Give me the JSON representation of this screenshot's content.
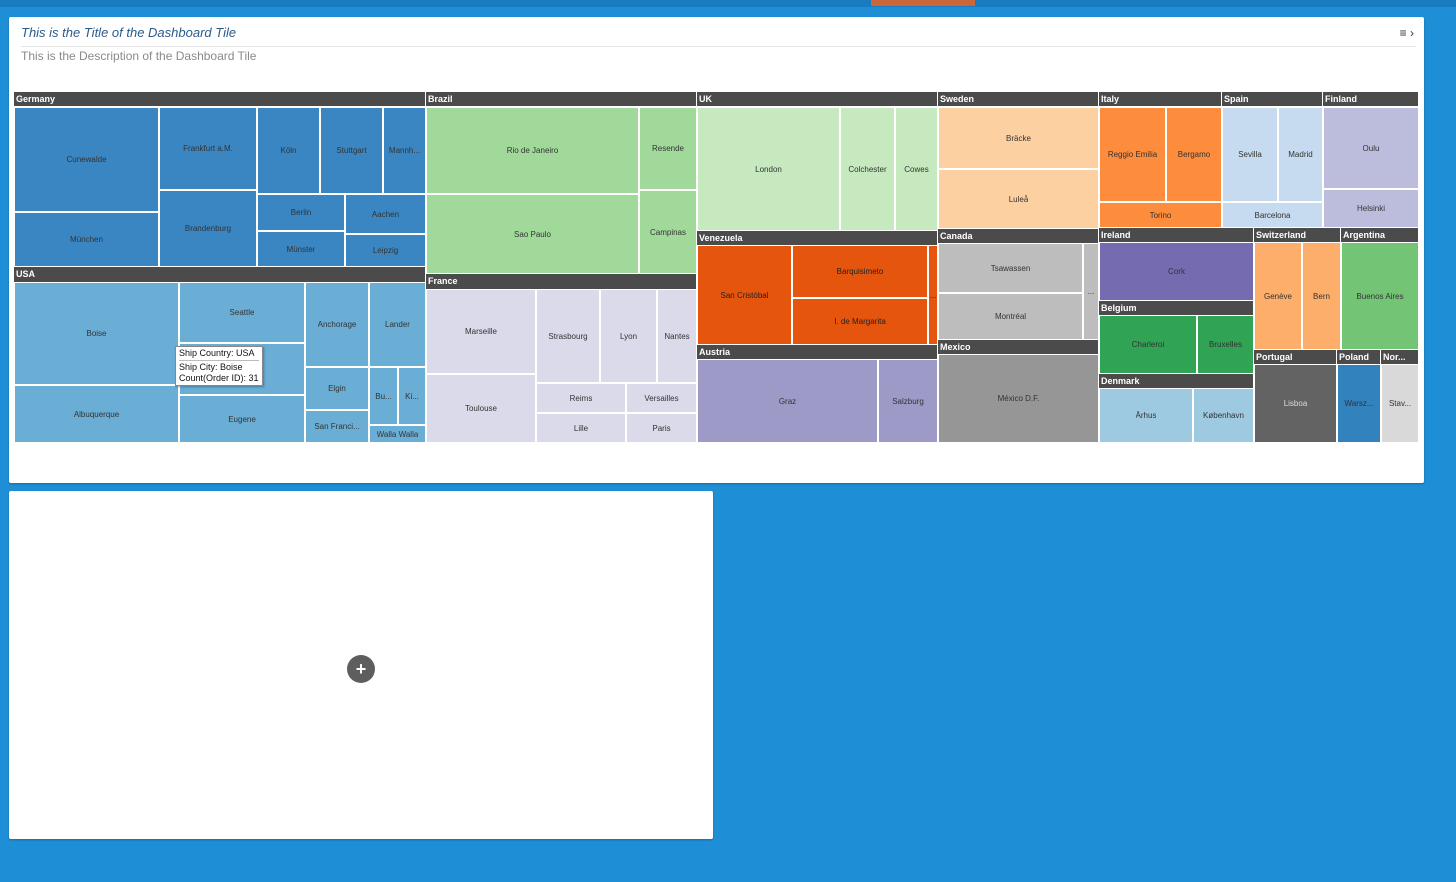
{
  "tile": {
    "title": "This is the Title of the Dashboard Tile",
    "description": "This is the Description of the Dashboard Tile",
    "menu_icon": "hamburger-icon",
    "expand_icon": "chevron-right-icon"
  },
  "tooltip": {
    "country_label": "Ship Country:",
    "country_value": "USA",
    "city_label": "Ship City:",
    "city_value": "Boise",
    "count_label": "Count(Order ID):",
    "count_value": "31"
  },
  "empty_tile": {
    "add_icon": "plus-circle-icon",
    "add_symbol": "+"
  },
  "chart_data": {
    "type": "treemap",
    "measure": "Count(Order ID)",
    "groups": [
      {
        "name": "Germany",
        "color": "#3a86c2",
        "children": [
          "Cunewalde",
          "München",
          "Frankfurt a.M.",
          "Brandenburg",
          "Köln",
          "Stuttgart",
          "Mannh...",
          "Berlin",
          "Aachen",
          "Münster",
          "Leipzig"
        ]
      },
      {
        "name": "USA",
        "color": "#6aaed6",
        "children": [
          "Boise",
          "Albuquerque",
          "Seattle",
          "Eugene",
          "Anchorage",
          "Elgin",
          "San Franci...",
          "Lander",
          "Bu...",
          "Ki...",
          "Walla Walla"
        ]
      },
      {
        "name": "Brazil",
        "color": "#a1d99b",
        "children": [
          "Rio de Janeiro",
          "Sao Paulo",
          "Resende",
          "Campinas"
        ]
      },
      {
        "name": "France",
        "color": "#dadaeb",
        "children": [
          "Marseille",
          "Toulouse",
          "Strasbourg",
          "Lyon",
          "Nantes",
          "Reims",
          "Versailles",
          "Lille",
          "Paris"
        ]
      },
      {
        "name": "UK",
        "color": "#c7e9c0",
        "children": [
          "London",
          "Colchester",
          "Cowes"
        ]
      },
      {
        "name": "Venezuela",
        "color": "#e6550d",
        "children": [
          "San Cristóbal",
          "Barquisimeto",
          "I. de Margarita",
          "..."
        ]
      },
      {
        "name": "Austria",
        "color": "#9e9ac8",
        "children": [
          "Graz",
          "Salzburg"
        ]
      },
      {
        "name": "Sweden",
        "color": "#fdd0a2",
        "children": [
          "Bräcke",
          "Luleå"
        ]
      },
      {
        "name": "Canada",
        "color": "#bdbdbd",
        "children": [
          "Tsawassen",
          "Montréal",
          "..."
        ]
      },
      {
        "name": "Mexico",
        "color": "#969696",
        "children": [
          "México D.F."
        ]
      },
      {
        "name": "Italy",
        "color": "#fd8d3c",
        "children": [
          "Reggio Emilia",
          "Bergamo",
          "Torino"
        ]
      },
      {
        "name": "Spain",
        "color": "#c6dbef",
        "children": [
          "Sevilla",
          "Madrid",
          "Barcelona"
        ]
      },
      {
        "name": "Finland",
        "color": "#bcbddc",
        "children": [
          "Oulu",
          "Helsinki"
        ]
      },
      {
        "name": "Ireland",
        "color": "#756bb1",
        "children": [
          "Cork"
        ]
      },
      {
        "name": "Belgium",
        "color": "#31a354",
        "children": [
          "Charleroi",
          "Bruxelles"
        ]
      },
      {
        "name": "Denmark",
        "color": "#9ecae1",
        "children": [
          "Århus",
          "København"
        ]
      },
      {
        "name": "Switzerland",
        "color": "#fdae6b",
        "children": [
          "Genève",
          "Bern"
        ]
      },
      {
        "name": "Argentina",
        "color": "#74c476",
        "children": [
          "Buenos Aires"
        ]
      },
      {
        "name": "Portugal",
        "color": "#636363",
        "children": [
          "Lisboa"
        ]
      },
      {
        "name": "Poland",
        "color": "#3182bd",
        "children": [
          "Warsz..."
        ]
      },
      {
        "name": "Nor...",
        "color": "#d9d9d9",
        "children": [
          "Stav..."
        ]
      }
    ]
  }
}
